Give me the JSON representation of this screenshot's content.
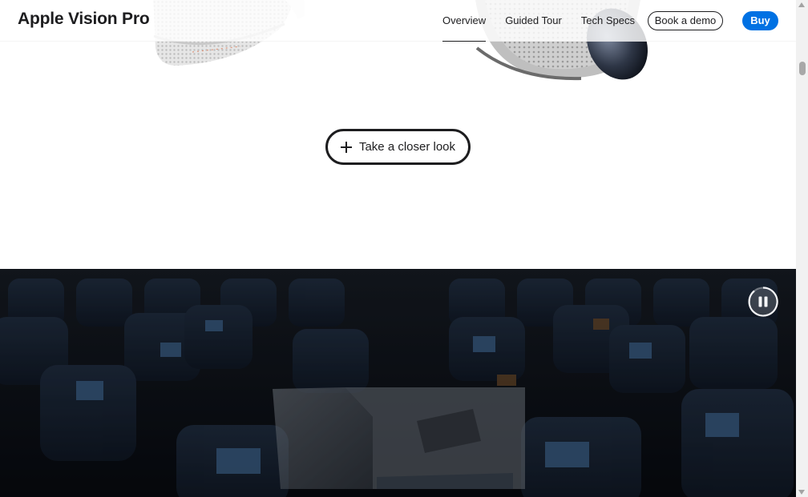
{
  "localnav": {
    "title": "Apple Vision Pro",
    "links": [
      {
        "label": "Overview",
        "current": true
      },
      {
        "label": "Guided Tour",
        "current": false
      },
      {
        "label": "Tech Specs",
        "current": false
      }
    ],
    "demo_label": "Book a demo",
    "buy_label": "Buy"
  },
  "closer_look": {
    "label": "Take a closer look",
    "icon": "plus-icon"
  },
  "video": {
    "control_icon": "pause-icon",
    "state": "playing"
  },
  "colors": {
    "accent": "#0071e3",
    "text": "#1d1d1f",
    "video_bg": "#0b0f17"
  }
}
